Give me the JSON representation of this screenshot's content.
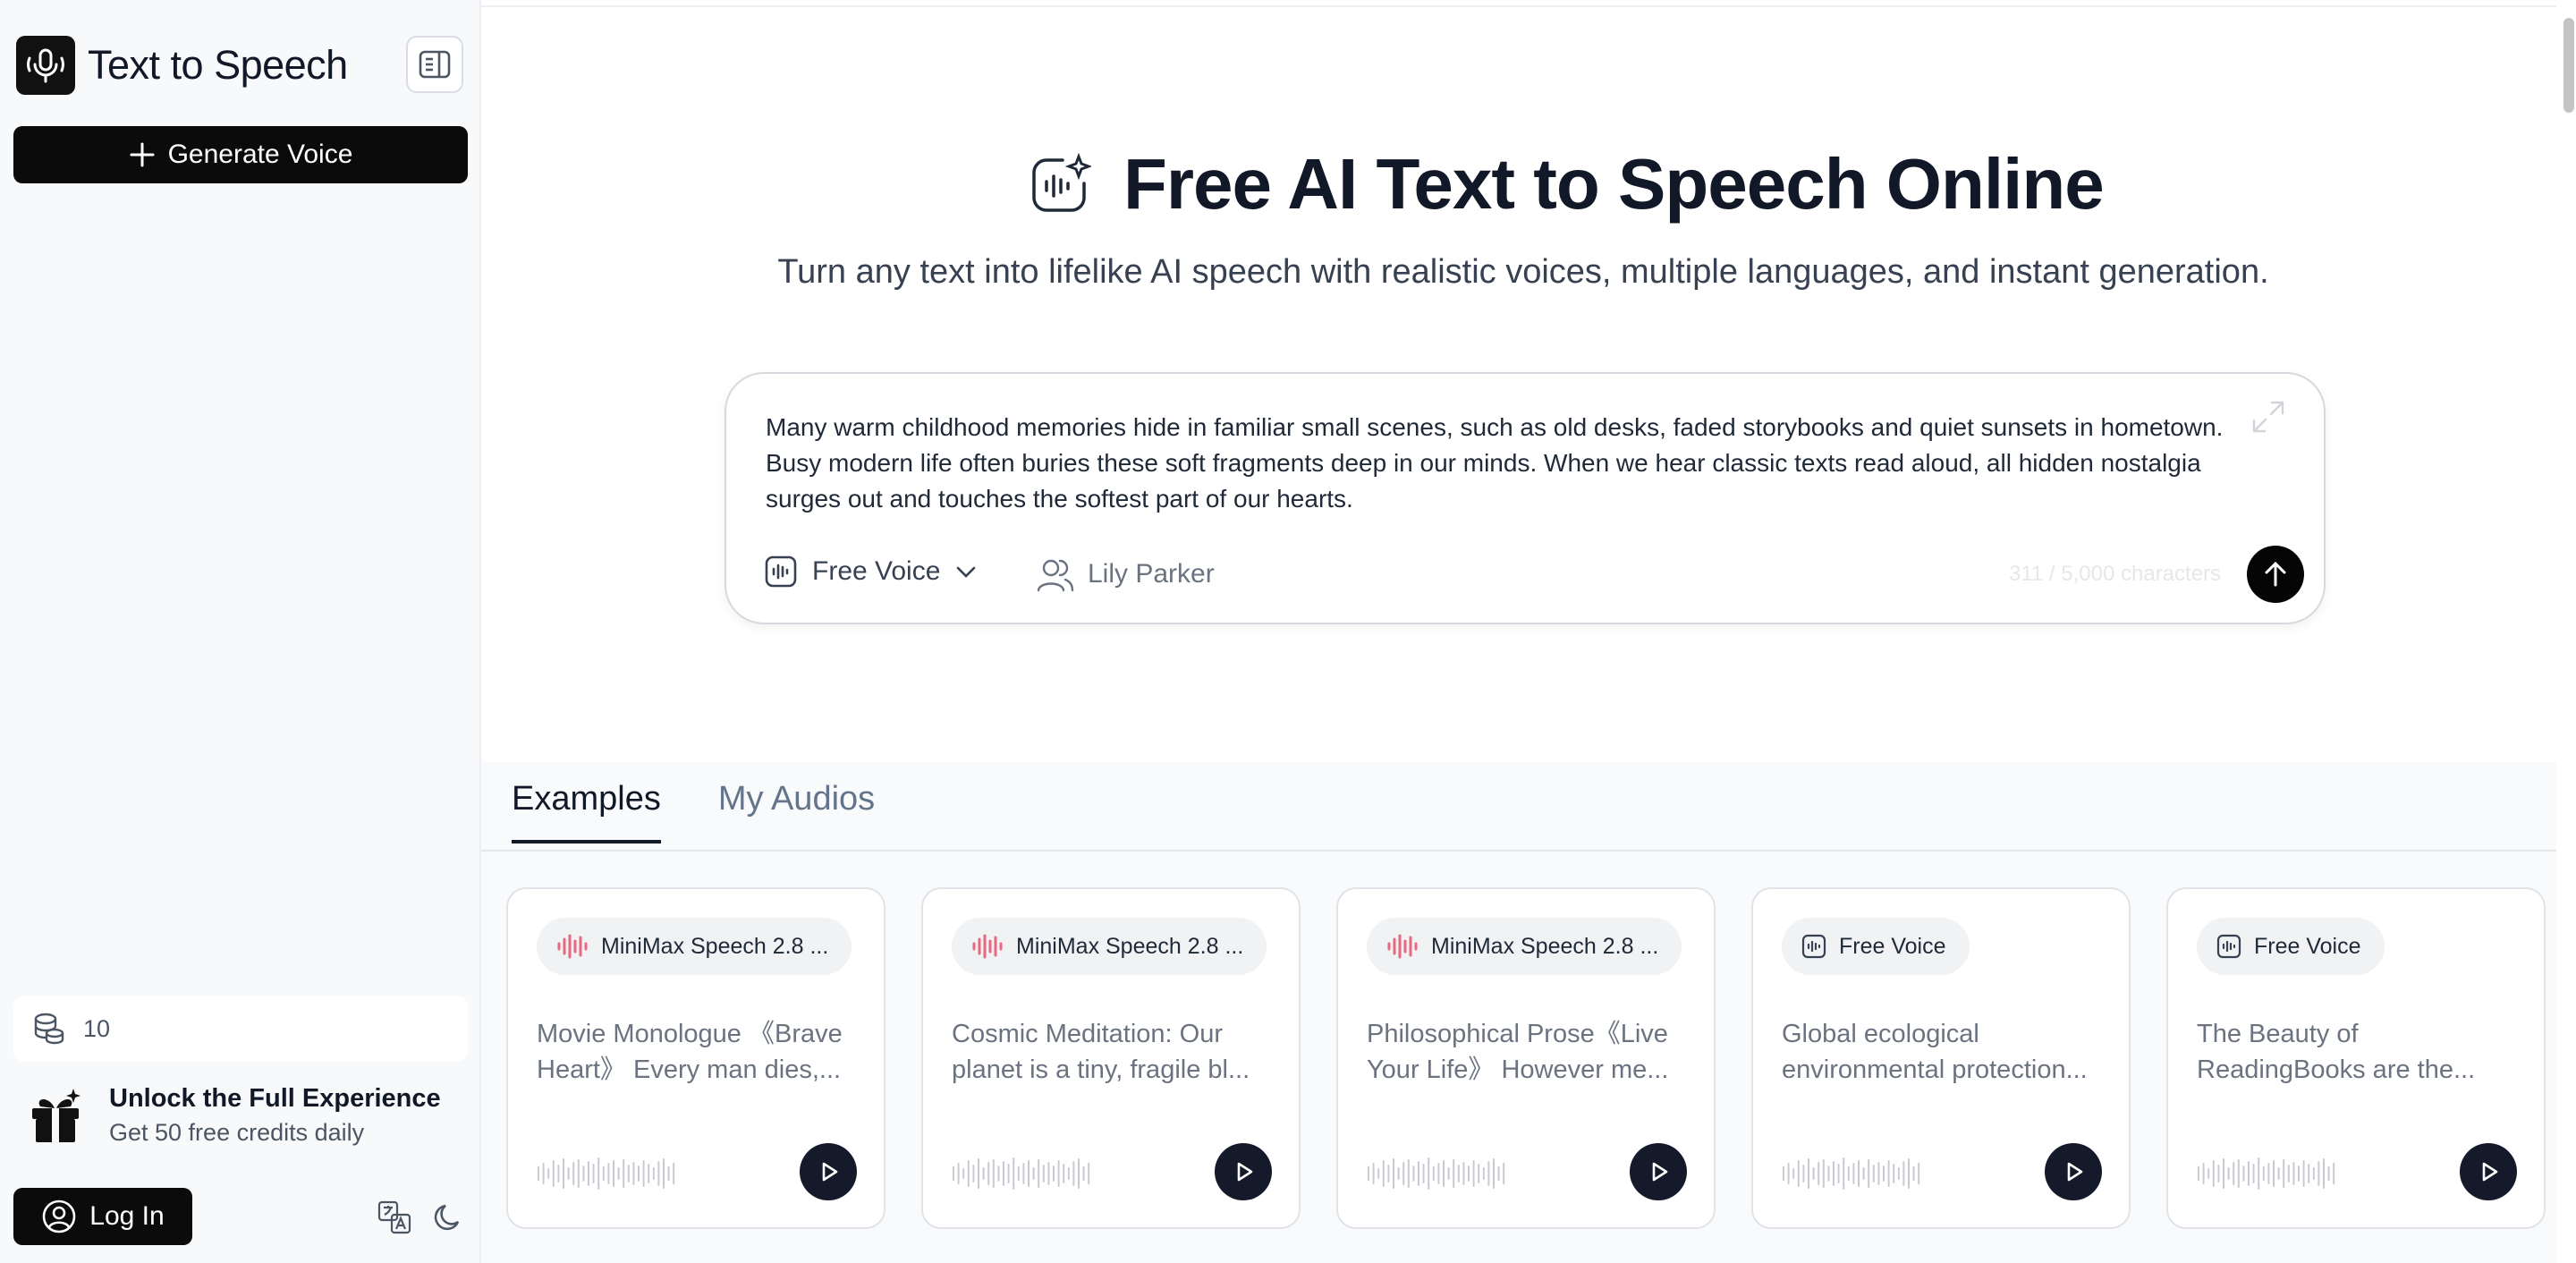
{
  "sidebar": {
    "brand_title": "Text to Speech",
    "generate_label": "Generate Voice",
    "credits": "10",
    "promo_title": "Unlock the Full Experience",
    "promo_subtitle": "Get 50 free credits daily",
    "login_label": "Log In"
  },
  "hero": {
    "title": "Free AI Text to Speech Online",
    "subtitle": "Turn any text into lifelike AI speech with realistic voices, multiple languages, and instant generation."
  },
  "input": {
    "text": "Many warm childhood memories hide in familiar small scenes, such as old desks, faded storybooks and quiet sunsets in hometown. Busy modern life often buries these soft fragments deep in our minds. When we hear classic texts read aloud, all hidden nostalgia surges out and touches the softest part of our hearts.",
    "voice_model": "Free Voice",
    "speaker": "Lily Parker",
    "char_count": "311 / 5,000 characters"
  },
  "tabs": [
    {
      "label": "Examples"
    },
    {
      "label": "My Audios"
    }
  ],
  "cards": [
    {
      "badge": "MiniMax Speech 2.8 ...",
      "text": "Movie Monologue 《Brave Heart》 Every man dies,...",
      "badge_icon": "pink-waveform-icon"
    },
    {
      "badge": "MiniMax Speech 2.8 ...",
      "text": "Cosmic Meditation: Our planet is a tiny, fragile bl...",
      "badge_icon": "pink-waveform-icon"
    },
    {
      "badge": "MiniMax Speech 2.8 ...",
      "text": "Philosophical Prose《Live Your Life》 However me...",
      "badge_icon": "pink-waveform-icon"
    },
    {
      "badge": "Free Voice",
      "text": "Global ecological environmental protection...",
      "badge_icon": "voice-box-icon"
    },
    {
      "badge": "Free Voice",
      "text": "The Beauty of ReadingBooks are the...",
      "badge_icon": "voice-box-icon"
    }
  ],
  "colors": {
    "accent_pink": "#e8677f",
    "button_dark": "#0b0b0b",
    "play_button": "#151a2b"
  }
}
